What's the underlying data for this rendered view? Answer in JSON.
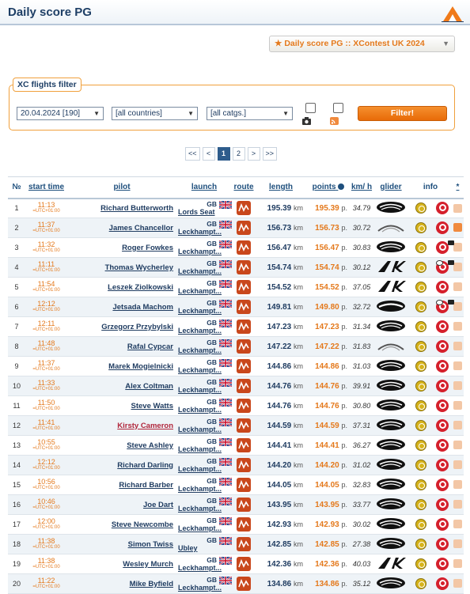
{
  "header": {
    "title": "Daily score PG",
    "logo_icon": "xcontest-logo-icon"
  },
  "contest_select": {
    "value": "★ Daily score PG :: XContest UK 2024"
  },
  "filter": {
    "legend": "XC flights filter",
    "date": "20.04.2024 [190]",
    "countries": "[all countries]",
    "categories": "[all catgs.]",
    "button": "Filter!"
  },
  "pager": {
    "first": "<<",
    "prev": "<",
    "pages": [
      "1",
      "2"
    ],
    "next": ">",
    "last": ">>"
  },
  "table": {
    "headers": {
      "no": "№",
      "start_time": "start time",
      "pilot": "pilot",
      "launch": "launch",
      "route": "route",
      "length": "length",
      "points": "points",
      "kmh": "km/ h",
      "glider": "glider",
      "info": "info",
      "star": "*"
    },
    "unit_km": "km",
    "unit_p": "p.",
    "tz": "=UTC+01:00",
    "rows": [
      {
        "no": "1",
        "time": "11:13",
        "pilot": "Richard Butterworth",
        "cc": "GB",
        "site": "Lords Seat",
        "len": "195.39",
        "pts": "195.39",
        "kmh": "34.79",
        "glider": "wing-1",
        "bubble": false,
        "camera": false,
        "rss": false
      },
      {
        "no": "2",
        "time": "11:37",
        "pilot": "James Chancellor",
        "cc": "GB",
        "site": "Leckhampt...",
        "len": "156.73",
        "pts": "156.73",
        "kmh": "30.72",
        "glider": "wing-2",
        "bubble": false,
        "camera": false,
        "rss": true
      },
      {
        "no": "3",
        "time": "11:32",
        "pilot": "Roger Fowkes",
        "cc": "GB",
        "site": "Leckhampt...",
        "len": "156.47",
        "pts": "156.47",
        "kmh": "30.83",
        "glider": "wing-1",
        "bubble": false,
        "camera": true,
        "rss": false
      },
      {
        "no": "4",
        "time": "11:11",
        "pilot": "Thomas Wycherley",
        "cc": "GB",
        "site": "Leckhampt...",
        "len": "154.74",
        "pts": "154.74",
        "kmh": "30.12",
        "glider": "wing-3",
        "bubble": true,
        "camera": true,
        "rss": false
      },
      {
        "no": "5",
        "time": "11:54",
        "pilot": "Leszek Ziolkowski",
        "cc": "GB",
        "site": "Leckhampt...",
        "len": "154.52",
        "pts": "154.52",
        "kmh": "37.05",
        "glider": "wing-3",
        "bubble": false,
        "camera": false,
        "rss": false
      },
      {
        "no": "6",
        "time": "12:12",
        "pilot": "Jetsada Machom",
        "cc": "GB",
        "site": "Leckhampt...",
        "len": "149.81",
        "pts": "149.80",
        "kmh": "32.72",
        "glider": "wing-4",
        "bubble": true,
        "camera": true,
        "rss": false
      },
      {
        "no": "7",
        "time": "12:11",
        "pilot": "Grzegorz Przybylski",
        "cc": "GB",
        "site": "Leckhampt...",
        "len": "147.23",
        "pts": "147.23",
        "kmh": "31.34",
        "glider": "wing-1",
        "bubble": false,
        "camera": false,
        "rss": false
      },
      {
        "no": "8",
        "time": "11:48",
        "pilot": "Rafal Cypcar",
        "cc": "GB",
        "site": "Leckhampt...",
        "len": "147.22",
        "pts": "147.22",
        "kmh": "31.83",
        "glider": "wing-2",
        "bubble": false,
        "camera": false,
        "rss": false
      },
      {
        "no": "9",
        "time": "11:37",
        "pilot": "Marek Mogielnicki",
        "cc": "GB",
        "site": "Leckhampt...",
        "len": "144.86",
        "pts": "144.86",
        "kmh": "31.03",
        "glider": "wing-1",
        "bubble": false,
        "camera": false,
        "rss": false
      },
      {
        "no": "10",
        "time": "11:33",
        "pilot": "Alex Coltman",
        "cc": "GB",
        "site": "Leckhampt...",
        "len": "144.76",
        "pts": "144.76",
        "kmh": "39.91",
        "glider": "wing-1",
        "bubble": false,
        "camera": false,
        "rss": false
      },
      {
        "no": "11",
        "time": "11:50",
        "pilot": "Steve Watts",
        "cc": "GB",
        "site": "Leckhampt...",
        "len": "144.76",
        "pts": "144.76",
        "kmh": "30.80",
        "glider": "wing-1",
        "bubble": false,
        "camera": false,
        "rss": false
      },
      {
        "no": "12",
        "time": "11:41",
        "pilot": "Kirsty Cameron",
        "cc": "GB",
        "site": "Leckhampt...",
        "len": "144.59",
        "pts": "144.59",
        "kmh": "37.31",
        "glider": "wing-1",
        "bubble": false,
        "camera": false,
        "rss": false,
        "red": true
      },
      {
        "no": "13",
        "time": "10:55",
        "pilot": "Steve Ashley",
        "cc": "GB",
        "site": "Leckhampt...",
        "len": "144.41",
        "pts": "144.41",
        "kmh": "36.27",
        "glider": "wing-1",
        "bubble": false,
        "camera": false,
        "rss": false
      },
      {
        "no": "14",
        "time": "12:12",
        "pilot": "Richard Darling",
        "cc": "GB",
        "site": "Leckhampt...",
        "len": "144.20",
        "pts": "144.20",
        "kmh": "31.02",
        "glider": "wing-1",
        "bubble": false,
        "camera": false,
        "rss": false
      },
      {
        "no": "15",
        "time": "10:56",
        "pilot": "Richard Barber",
        "cc": "GB",
        "site": "Leckhampt...",
        "len": "144.05",
        "pts": "144.05",
        "kmh": "32.83",
        "glider": "wing-1",
        "bubble": false,
        "camera": false,
        "rss": false
      },
      {
        "no": "16",
        "time": "10:46",
        "pilot": "Joe Dart",
        "cc": "GB",
        "site": "Leckhampt...",
        "len": "143.95",
        "pts": "143.95",
        "kmh": "33.77",
        "glider": "wing-1",
        "bubble": false,
        "camera": false,
        "rss": false
      },
      {
        "no": "17",
        "time": "12:00",
        "pilot": "Steve Newcombe",
        "cc": "GB",
        "site": "Leckhampt...",
        "len": "142.93",
        "pts": "142.93",
        "kmh": "30.02",
        "glider": "wing-1",
        "bubble": false,
        "camera": false,
        "rss": false
      },
      {
        "no": "18",
        "time": "11:38",
        "pilot": "Simon Twiss",
        "cc": "GB",
        "site": "Ubley",
        "len": "142.85",
        "pts": "142.85",
        "kmh": "27.38",
        "glider": "wing-1",
        "bubble": false,
        "camera": false,
        "rss": false
      },
      {
        "no": "19",
        "time": "11:38",
        "pilot": "Wesley Murch",
        "cc": "GB",
        "site": "Leckhampt...",
        "len": "142.36",
        "pts": "142.36",
        "kmh": "40.03",
        "glider": "wing-3",
        "bubble": false,
        "camera": false,
        "rss": false
      },
      {
        "no": "20",
        "time": "11:22",
        "pilot": "Mike Byfield",
        "cc": "GB",
        "site": "Leckhampt...",
        "len": "134.86",
        "pts": "134.86",
        "kmh": "35.12",
        "glider": "wing-1",
        "bubble": false,
        "camera": false,
        "rss": false
      }
    ]
  }
}
